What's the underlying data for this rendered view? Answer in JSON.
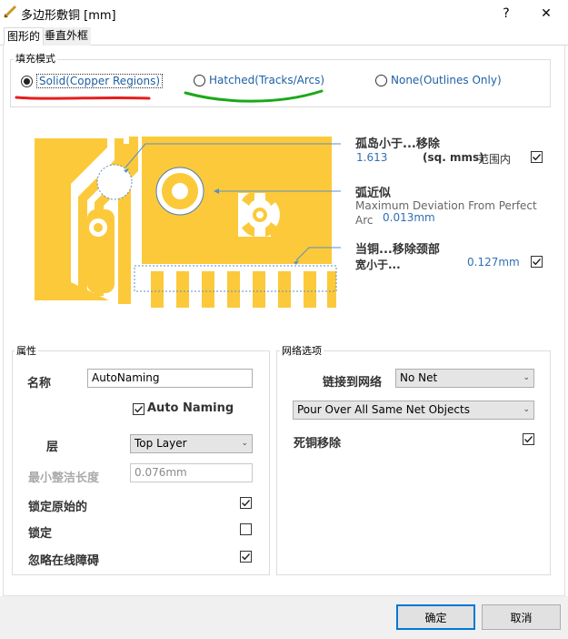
{
  "window": {
    "title": "多边形敷铜 [mm]",
    "help_label": "?",
    "close_label": "✕"
  },
  "tabs": [
    {
      "label": "图形的"
    },
    {
      "label": "垂直外框"
    }
  ],
  "fill_mode": {
    "group_label": "填充模式",
    "options": [
      {
        "label": "Solid(Copper Regions)",
        "selected": true
      },
      {
        "label": "Hatched(Tracks/Arcs)",
        "selected": false
      },
      {
        "label": "None(Outlines Only)",
        "selected": false
      }
    ]
  },
  "preview": {
    "island": {
      "label": "孤岛小于...移除",
      "value": "1.613",
      "unit": "(sq. mms)",
      "range_label": "范围内",
      "checked": true
    },
    "arc": {
      "label": "弧近似",
      "desc_line1": "Maximum Deviation From Perfect",
      "desc_line2": "Arc",
      "value": "0.013mm"
    },
    "neck": {
      "label": "当铜...移除颈部",
      "label2": "宽小于...",
      "value": "0.127mm",
      "checked": true
    }
  },
  "properties": {
    "group_label": "属性",
    "name_label": "名称",
    "name_value": "AutoNaming",
    "auto_naming_label": "Auto Naming",
    "auto_naming_checked": true,
    "layer_label": "层",
    "layer_value": "Top Layer",
    "min_prim_label": "最小整洁长度",
    "min_prim_value": "0.076mm",
    "lock_primitives_label": "锁定原始的",
    "lock_primitives_checked": true,
    "locked_label": "锁定",
    "locked_checked": false,
    "ignore_obstacles_label": "忽略在线障碍",
    "ignore_obstacles_checked": true
  },
  "net_options": {
    "group_label": "网络选项",
    "connect_label": "链接到网络",
    "net_value": "No Net",
    "pour_value": "Pour Over All Same Net Objects",
    "remove_dead_label": "死铜移除",
    "remove_dead_checked": true
  },
  "footer": {
    "ok_label": "确定",
    "cancel_label": "取消"
  },
  "colors": {
    "copper": "#fcc93a",
    "accent_blue": "#2f6fb5",
    "annotation_red": "#e61e1e",
    "annotation_green": "#1aa91a"
  }
}
